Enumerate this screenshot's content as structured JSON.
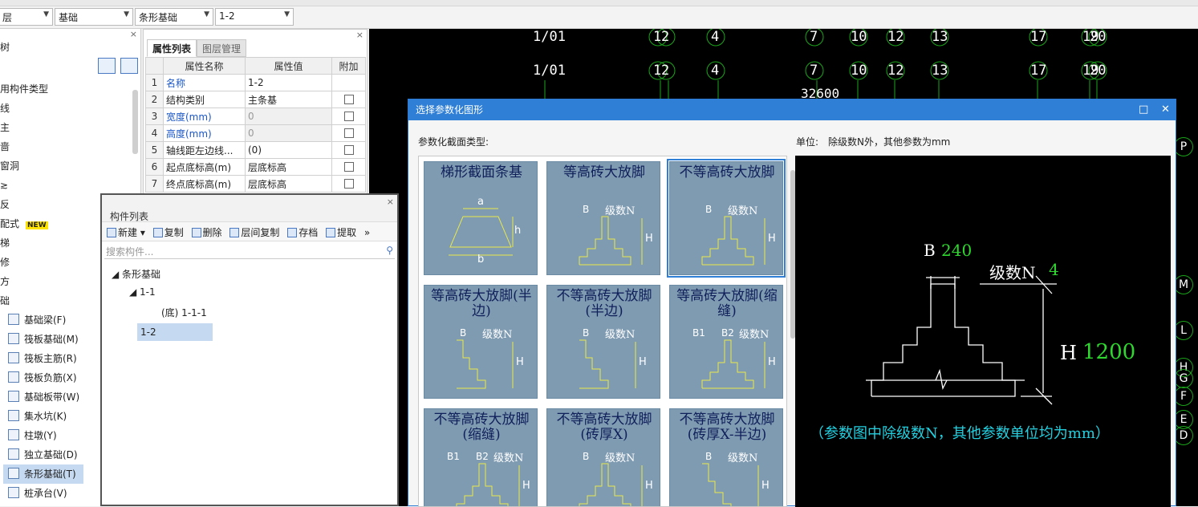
{
  "selectors": {
    "floor": "层",
    "category": "基础",
    "type": "条形基础",
    "element": "1-2"
  },
  "tree": {
    "title": "树",
    "items": [
      {
        "label": "用构件类型",
        "icon": "folder-icon"
      },
      {
        "label": "线",
        "icon": "folder-icon"
      },
      {
        "label": "主",
        "icon": "folder-icon"
      },
      {
        "label": "啬",
        "icon": "folder-icon"
      },
      {
        "label": "窗洞",
        "icon": "folder-icon"
      },
      {
        "label": "≳",
        "icon": "folder-icon"
      },
      {
        "label": "反",
        "icon": "folder-icon"
      },
      {
        "label": "配式",
        "icon": "folder-icon",
        "badge": "NEW"
      },
      {
        "label": "梯",
        "icon": "folder-icon"
      },
      {
        "label": "修",
        "icon": "folder-icon"
      },
      {
        "label": "方",
        "icon": "folder-icon"
      },
      {
        "label": "础",
        "icon": "folder-icon"
      },
      {
        "label": "基础梁(F)",
        "icon": "beam-icon"
      },
      {
        "label": "筏板基础(M)",
        "icon": "raft-icon"
      },
      {
        "label": "筏板主筋(R)",
        "icon": "rebar-icon"
      },
      {
        "label": "筏板负筋(X)",
        "icon": "rebar-neg-icon"
      },
      {
        "label": "基础板带(W)",
        "icon": "strip-icon"
      },
      {
        "label": "集水坑(K)",
        "icon": "sump-icon"
      },
      {
        "label": "柱墩(Y)",
        "icon": "pier-icon"
      },
      {
        "label": "独立基础(D)",
        "icon": "footing-icon"
      },
      {
        "label": "条形基础(T)",
        "icon": "strip-footing-icon",
        "selected": true
      },
      {
        "label": "桩承台(V)",
        "icon": "pile-cap-icon"
      }
    ]
  },
  "props": {
    "tabs": [
      "属性列表",
      "图层管理"
    ],
    "headers": [
      "属性名称",
      "属性值",
      "附加"
    ],
    "rows": [
      {
        "n": "1",
        "name": "名称",
        "value": "1-2",
        "blue": true,
        "check": false
      },
      {
        "n": "2",
        "name": "结构类别",
        "value": "主条基",
        "blue": false,
        "check": true
      },
      {
        "n": "3",
        "name": "宽度(mm)",
        "value": "0",
        "blue": true,
        "check": true,
        "grey": true
      },
      {
        "n": "4",
        "name": "高度(mm)",
        "value": "0",
        "blue": true,
        "check": true,
        "grey": true
      },
      {
        "n": "5",
        "name": "轴线距左边线...",
        "value": "(0)",
        "blue": false,
        "check": true
      },
      {
        "n": "6",
        "name": "起点底标高(m)",
        "value": "层底标高",
        "blue": false,
        "check": true
      },
      {
        "n": "7",
        "name": "终点底标高(m)",
        "value": "层底标高",
        "blue": false,
        "check": true
      }
    ]
  },
  "comp": {
    "title": "构件列表",
    "toolbar": [
      "新建",
      "复制",
      "删除",
      "层间复制",
      "存档",
      "提取"
    ],
    "search_placeholder": "搜索构件...",
    "tree": {
      "root": "条形基础",
      "child": "1-1",
      "leaf": "(底) 1-1-1",
      "sel": "1-2"
    }
  },
  "cad": {
    "axes_top": [
      "1/01",
      "1",
      "2",
      "4",
      "7",
      "10",
      "12",
      "13",
      "17",
      "19",
      "20"
    ],
    "dim": "32600",
    "axes_right": [
      "P",
      "M",
      "L",
      "H",
      "G",
      "F",
      "E",
      "D"
    ]
  },
  "dialog": {
    "title": "选择参数化图形",
    "type_label": "参数化截面类型:",
    "unit_label": "单位:",
    "unit_text": "除级数N外，其他参数为mm",
    "shapes": [
      {
        "title": "梯形截面条基"
      },
      {
        "title": "等高砖大放脚"
      },
      {
        "title": "不等高砖大放脚",
        "selected": true
      },
      {
        "title": "等高砖大放脚(半边)"
      },
      {
        "title": "不等高砖大放脚(半边)"
      },
      {
        "title": "等高砖大放脚(缩缝)"
      },
      {
        "title": "不等高砖大放脚(缩缝)"
      },
      {
        "title": "不等高砖大放脚(砖厚X)"
      },
      {
        "title": "不等高砖大放脚(砖厚X-半边)"
      }
    ],
    "marks": {
      "a": "a",
      "b": "b",
      "h": "h",
      "B": "B",
      "N": "级数N",
      "H": "H",
      "B1": "B1",
      "B2": "B2"
    },
    "preview": {
      "B_label": "B",
      "B_value": "240",
      "N_label": "级数N",
      "N_value": "4",
      "H_label": "H",
      "H_value": "1200",
      "note": "（参数图中除级数N，其他参数单位均为mm）"
    }
  }
}
